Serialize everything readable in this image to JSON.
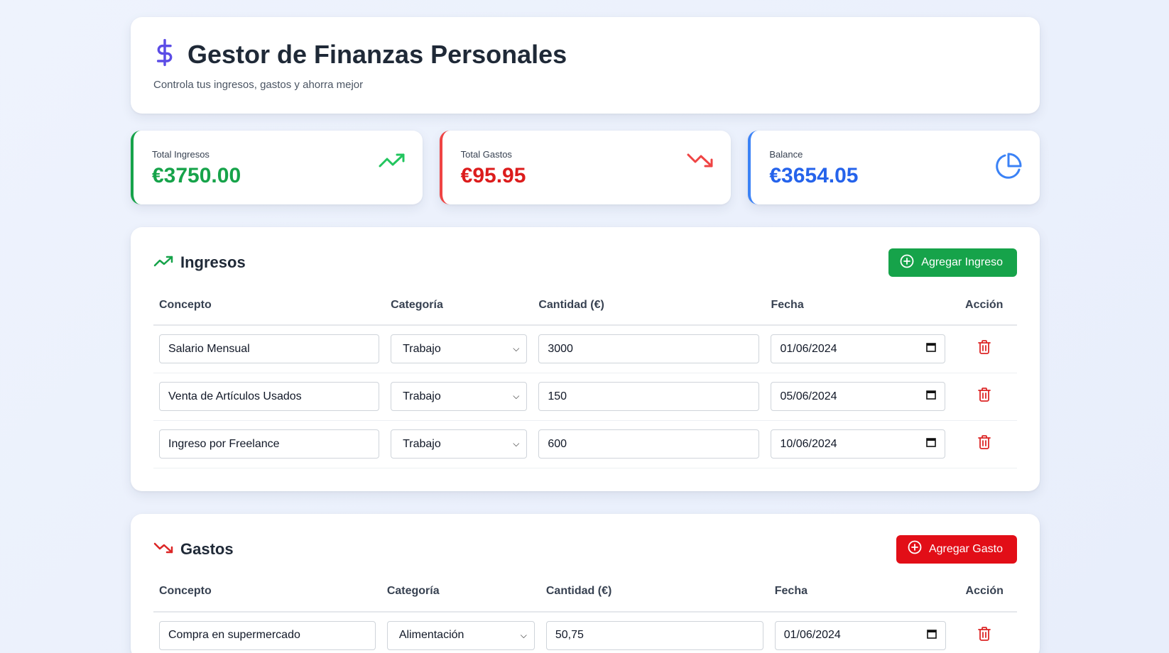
{
  "header": {
    "title": "Gestor de Finanzas Personales",
    "subtitle": "Controla tus ingresos, gastos y ahorra mejor"
  },
  "summary": {
    "income": {
      "label": "Total Ingresos",
      "value": "€3750.00",
      "icon": "trending-up-icon"
    },
    "expenses": {
      "label": "Total Gastos",
      "value": "€95.95",
      "icon": "trending-down-icon"
    },
    "balance": {
      "label": "Balance",
      "value": "€3654.05",
      "icon": "pie-chart-icon"
    }
  },
  "income_section": {
    "title": "Ingresos",
    "add_label": "Agregar Ingreso",
    "columns": [
      "Concepto",
      "Categoría",
      "Cantidad (€)",
      "Fecha",
      "Acción"
    ],
    "rows": [
      {
        "concept": "Salario Mensual",
        "category": "Trabajo",
        "amount": "3000",
        "date": "01/06/2024"
      },
      {
        "concept": "Venta de Artículos Usados",
        "category": "Trabajo",
        "amount": "150",
        "date": "05/06/2024"
      },
      {
        "concept": "Ingreso por Freelance",
        "category": "Trabajo",
        "amount": "600",
        "date": "10/06/2024"
      }
    ]
  },
  "expense_section": {
    "title": "Gastos",
    "add_label": "Agregar Gasto",
    "columns": [
      "Concepto",
      "Categoría",
      "Cantidad (€)",
      "Fecha",
      "Acción"
    ],
    "rows": [
      {
        "concept": "Compra en supermercado",
        "category": "Alimentación",
        "amount": "50,75",
        "date": "01/06/2024"
      }
    ]
  },
  "colors": {
    "accent_purple": "#5b4ce6",
    "income_green": "#16a34a",
    "expense_red": "#dc1c1c",
    "balance_blue": "#2563eb"
  }
}
